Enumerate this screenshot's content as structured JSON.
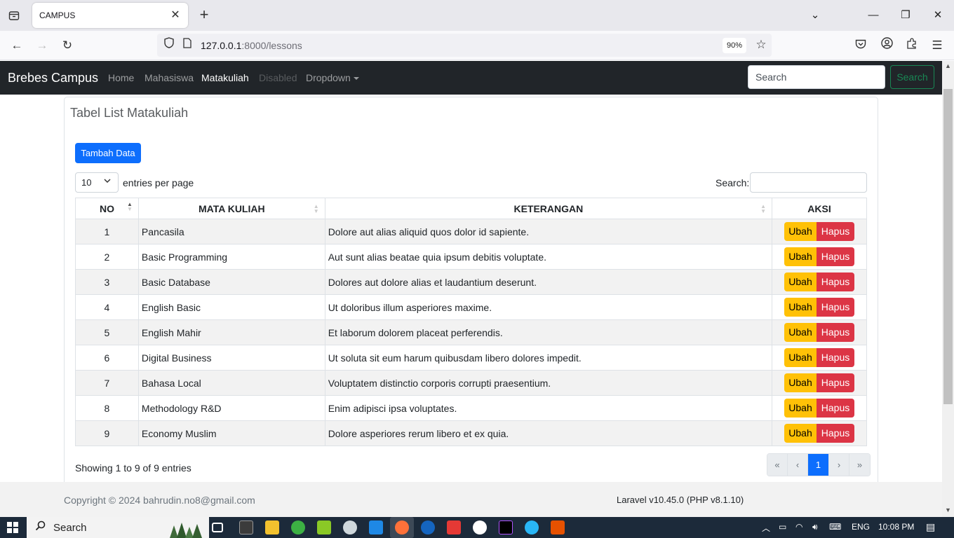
{
  "browser": {
    "tab_title": "CAMPUS",
    "url_host": "127.0.0.1",
    "url_path": ":8000/lessons",
    "zoom": "90%"
  },
  "navbar": {
    "brand": "Brebes Campus",
    "links": [
      "Home",
      "Mahasiswa",
      "Matakuliah",
      "Disabled",
      "Dropdown"
    ],
    "search_placeholder": "Search",
    "search_button": "Search"
  },
  "card": {
    "title": "Tabel List Matakuliah",
    "add_button": "Tambah Data",
    "entries_value": "10",
    "entries_label": "entries per page",
    "search_label": "Search:",
    "columns": [
      "NO",
      "MATA KULIAH",
      "KETERANGAN",
      "AKSI"
    ],
    "rows": [
      {
        "no": "1",
        "name": "Pancasila",
        "desc": "Dolore aut alias aliquid quos dolor id sapiente."
      },
      {
        "no": "2",
        "name": "Basic Programming",
        "desc": "Aut sunt alias beatae quia ipsum debitis voluptate."
      },
      {
        "no": "3",
        "name": "Basic Database",
        "desc": "Dolores aut dolore alias et laudantium deserunt."
      },
      {
        "no": "4",
        "name": "English Basic",
        "desc": "Ut doloribus illum asperiores maxime."
      },
      {
        "no": "5",
        "name": "English Mahir",
        "desc": "Et laborum dolorem placeat perferendis."
      },
      {
        "no": "6",
        "name": "Digital Business",
        "desc": "Ut soluta sit eum harum quibusdam libero dolores impedit."
      },
      {
        "no": "7",
        "name": "Bahasa Local",
        "desc": "Voluptatem distinctio corporis corrupti praesentium."
      },
      {
        "no": "8",
        "name": "Methodology R&D",
        "desc": "Enim adipisci ipsa voluptates."
      },
      {
        "no": "9",
        "name": "Economy Muslim",
        "desc": "Dolore asperiores rerum libero et ex quia."
      }
    ],
    "edit_label": "Ubah",
    "delete_label": "Hapus",
    "info": "Showing 1 to 9 of 9 entries",
    "pager": [
      "«",
      "‹",
      "1",
      "›",
      "»"
    ]
  },
  "footer": {
    "copyright": "Copyright © 2024 bahrudin.no8@gmail.com",
    "version": "Laravel v10.45.0 (PHP v8.1.10)"
  },
  "taskbar": {
    "search_text": "Search",
    "lang": "ENG",
    "time": "10:08 PM"
  },
  "colors": {
    "primary": "#0d6efd",
    "warning": "#ffc107",
    "danger": "#dc3545",
    "success": "#198754",
    "navbar": "#212529"
  }
}
